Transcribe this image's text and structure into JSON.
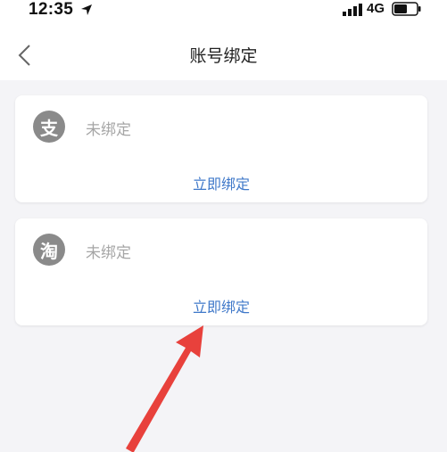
{
  "status_bar": {
    "time": "12:35",
    "network": "4G",
    "location_icon": "location-arrow-icon",
    "signal_icon": "signal-bars-icon",
    "battery_icon": "battery-icon"
  },
  "nav": {
    "back_icon": "chevron-left-icon",
    "title": "账号绑定"
  },
  "accounts": [
    {
      "logo_char": "支",
      "logo_icon": "alipay-logo-icon",
      "status": "未绑定",
      "action": "立即绑定"
    },
    {
      "logo_char": "淘",
      "logo_icon": "taobao-logo-icon",
      "status": "未绑定",
      "action": "立即绑定"
    }
  ],
  "annotation": {
    "arrow_color": "#e8413c",
    "icon": "red-arrow-annotation"
  },
  "colors": {
    "background": "#f4f4f7",
    "link": "#3f78c9",
    "muted_text": "#a6a6a6",
    "logo_bg": "#8a8a8a"
  }
}
